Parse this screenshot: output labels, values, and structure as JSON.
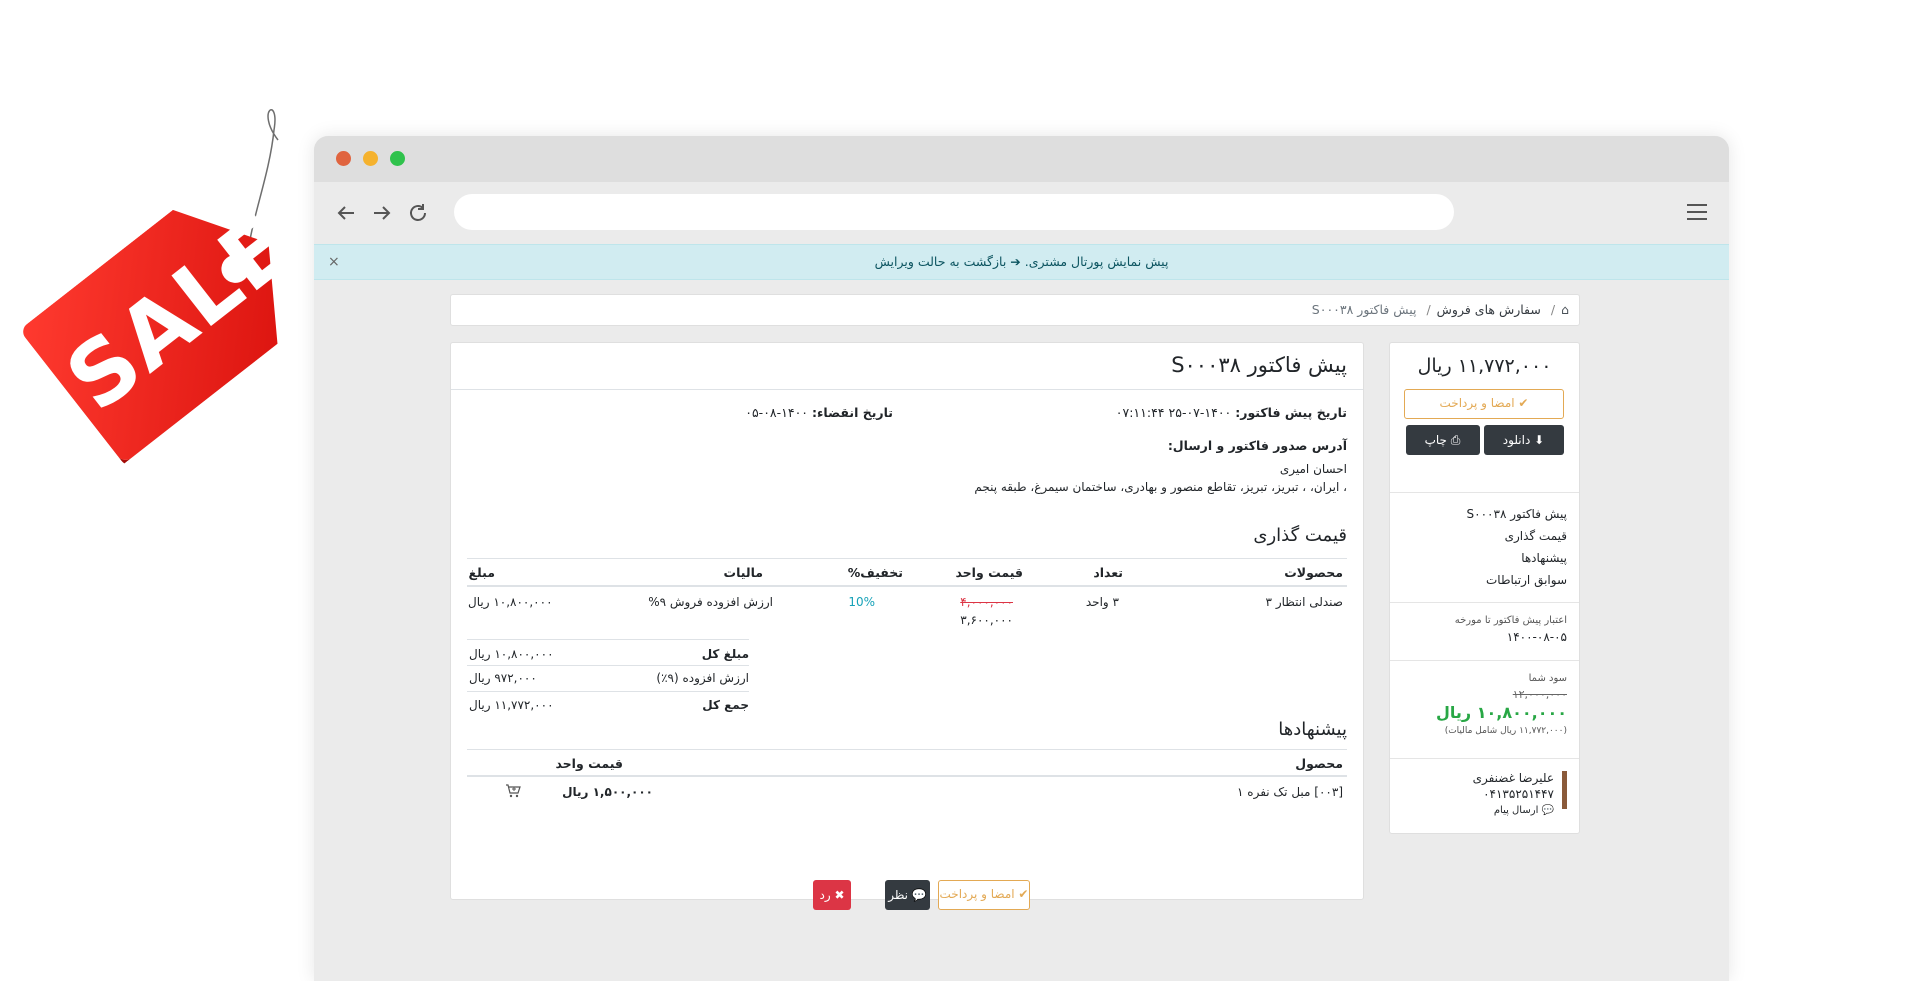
{
  "sale_tag": {
    "text": "SALE",
    "color": "#e8180f"
  },
  "browser": {
    "dots": [
      "#e0643f",
      "#f5b22e",
      "#2fc24c"
    ],
    "nav_icons": [
      "back-arrow-icon",
      "forward-arrow-icon",
      "reload-icon",
      "hamburger-menu-icon"
    ]
  },
  "alert": {
    "text": "پیش نمایش پورتال مشتری.",
    "link": "بازگشت به حالت ویرایش",
    "close": "×"
  },
  "breadcrumb": {
    "items": [
      "سفارش های فروش",
      "پیش فاکتور S۰۰۰۳۸"
    ],
    "separator": "/"
  },
  "sidebar": {
    "total": "۱۱,۷۷۲,۰۰۰ ریال",
    "sign_pay_label": "امضا و پرداخت",
    "download_label": "دانلود",
    "print_label": "چاپ",
    "nav": [
      "پیش فاکتور S۰۰۰۳۸",
      "قیمت گذاری",
      "پیشنهادها",
      "سوابق ارتباطات"
    ],
    "validity_label": "اعتبار پیش فاکتور تا مورخه",
    "validity_date": "۱۴۰۰-۰۸-۰۵",
    "savings_label": "سود شما",
    "savings_old": "۱۲,۰۰۰,۰۰۰",
    "savings_new": "۱۰,۸۰۰,۰۰۰ ریال",
    "savings_tax_note": "(۱۱,۷۷۲,۰۰۰ ریال شامل مالیات)",
    "salesperson_name": "علیرضا غضنفری",
    "salesperson_phone": "۰۴۱۳۵۲۵۱۴۴۷",
    "send_message_label": "ارسال پیام"
  },
  "quote": {
    "title": "پیش فاکتور S۰۰۰۳۸",
    "date_label": "تاریخ پیش فاکتور:",
    "date_value": "۱۴۰۰-۰۷-۲۵ ۰۷:۱۱:۴۴",
    "expiry_label": "تاریخ انقضاء:",
    "expiry_value": "۱۴۰۰-۰۸-۰۵",
    "address_label": "آدرس صدور فاکتور و ارسال:",
    "customer_name": "احسان امیری",
    "customer_address": "، ایران، ، تبریز، تبریز، تقاطع منصور و بهادری، ساختمان سیمرغ، طبقه پنجم"
  },
  "pricing": {
    "heading": "قیمت گذاری",
    "columns": [
      "محصولات",
      "تعداد",
      "قیمت واحد",
      "تخفیف%",
      "مالیات",
      "مبلغ"
    ],
    "rows": [
      {
        "product": "صندلی انتظار ۳",
        "qty": "۳ واحد",
        "unit_price_old": "۴,۰۰۰,۰۰۰",
        "unit_price_new": "۳,۶۰۰,۰۰۰",
        "discount": "10%",
        "tax": "ارزش افزوده فروش ۹%",
        "amount": "۱۰,۸۰۰,۰۰۰ ریال"
      }
    ],
    "totals": [
      {
        "label": "مبلغ کل",
        "value": "۱۰,۸۰۰,۰۰۰ ریال",
        "bold": true
      },
      {
        "label": "ارزش افزوده (۹٪)",
        "value": "۹۷۲,۰۰۰ ریال",
        "bold": false
      },
      {
        "label": "جمع کل",
        "value": "۱۱,۷۷۲,۰۰۰ ریال",
        "bold": true
      }
    ]
  },
  "options": {
    "heading": "پیشنهادها",
    "columns": [
      "محصول",
      "قیمت واحد"
    ],
    "rows": [
      {
        "product": "[۰۰۳] مبل تک نفره ۱",
        "price": "۱,۵۰۰,۰۰۰ ریال",
        "icon": "add-to-cart-icon"
      }
    ]
  },
  "bottom_buttons": {
    "sign_pay": "امضا و پرداخت",
    "feedback": "نظر",
    "reject": "رد"
  }
}
